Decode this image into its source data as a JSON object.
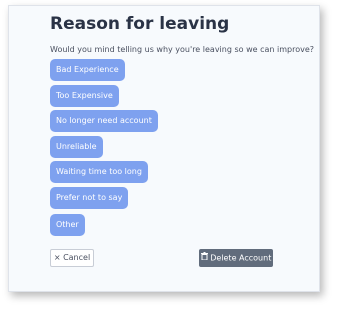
{
  "dialog": {
    "title": "Reason for leaving",
    "subtitle": "Would you mind telling us why you're leaving so we can improve?"
  },
  "reasons": [
    {
      "label": "Bad Experience"
    },
    {
      "label": "Too Expensive"
    },
    {
      "label": "No longer need account"
    },
    {
      "label": "Unreliable"
    },
    {
      "label": "Waiting time too long"
    },
    {
      "label": "Prefer not to say"
    },
    {
      "label": "Other"
    }
  ],
  "actions": {
    "cancel_icon": "×",
    "cancel_label": "Cancel",
    "delete_label": "Delete Account",
    "delete_icon_name": "trash-icon"
  },
  "colors": {
    "reason_bg": "#7ea1ef",
    "delete_bg": "#616c7c",
    "title": "#2a3346"
  }
}
